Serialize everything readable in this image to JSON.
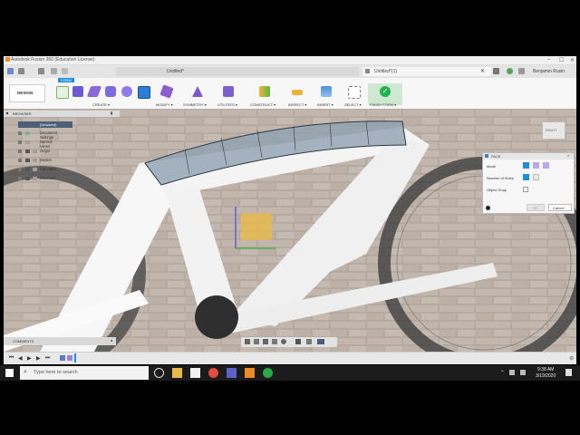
{
  "window": {
    "title": "Autodesk Fusion 360 (Education License)",
    "controls": [
      "–",
      "☐",
      "✕"
    ]
  },
  "tabs": [
    {
      "label": "Untitled*",
      "active": false
    },
    {
      "label": "Untitled*(1)",
      "active": true
    }
  ],
  "user": {
    "name": "Benjamin Rusin"
  },
  "toolbar": {
    "workspace": "DESIGN",
    "active_tab": "FORM",
    "groups": [
      {
        "label": "CREATE ▾"
      },
      {
        "label": "MODIFY ▾"
      },
      {
        "label": "SYMMETRY ▾"
      },
      {
        "label": "UTILITIES ▾"
      },
      {
        "label": "CONSTRUCT ▾"
      },
      {
        "label": "INSPECT ▾"
      },
      {
        "label": "INSERT ▾"
      },
      {
        "label": "SELECT ▾"
      },
      {
        "label": "FINISH FORM ▾"
      }
    ]
  },
  "browser": {
    "header": "BROWSER",
    "root": "(Unsaved)",
    "items": [
      {
        "label": "Document Settings"
      },
      {
        "label": "Named Views"
      },
      {
        "label": "Origin"
      },
      {
        "label": "Bodies"
      },
      {
        "label": "Canvases"
      },
      {
        "label": "Sketches"
      }
    ]
  },
  "face_dialog": {
    "title": "FACE",
    "rows": [
      {
        "label": "Mode"
      },
      {
        "label": "Number of Sides"
      },
      {
        "label": "Object Snap"
      }
    ],
    "ok": "OK",
    "cancel": "Cancel"
  },
  "viewcube": {
    "label": "RIGHT"
  },
  "comments": {
    "label": "COMMENTS"
  },
  "taskbar": {
    "search_placeholder": "Type here to search",
    "time": "9:38 AM",
    "date": "3/19/2020"
  },
  "colors": {
    "accent": "#1f8fdc",
    "finish": "#23b14d",
    "taskbar": "#1b1b1b"
  }
}
